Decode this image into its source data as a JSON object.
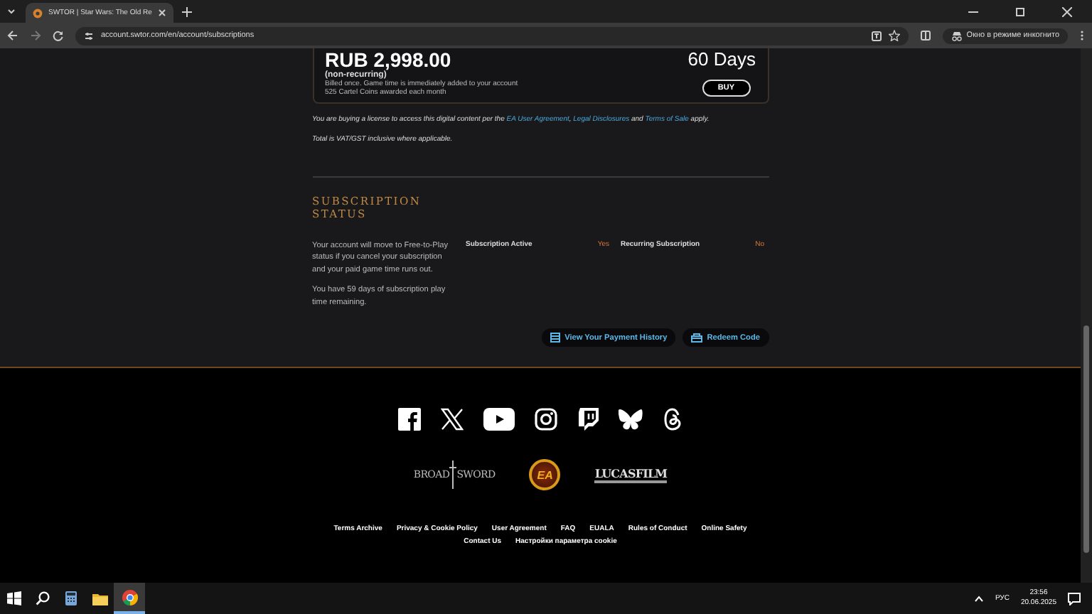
{
  "browser": {
    "tab_title": "SWTOR | Star Wars: The Old Re",
    "url": "account.swtor.com/en/account/subscriptions",
    "incognito_label": "Окно в режиме инкогнито"
  },
  "offer": {
    "price": "RUB 2,998.00",
    "note": "(non-recurring)",
    "details": [
      "Billed once. Game time is immediately added to your account",
      "525 Cartel Coins awarded each month"
    ],
    "duration": "60 Days",
    "buy_button": "BUY"
  },
  "legal": {
    "license_parts": [
      {
        "kind": "text",
        "text": "You are buying a license to access this digital content per the "
      },
      {
        "kind": "link",
        "text": "EA User Agreement"
      },
      {
        "kind": "text",
        "text": ", "
      },
      {
        "kind": "link",
        "text": "Legal Disclosures"
      },
      {
        "kind": "text",
        "text": " and "
      },
      {
        "kind": "link",
        "text": "Terms of Sale"
      },
      {
        "kind": "text",
        "text": " apply."
      }
    ],
    "vat_text": "Total is VAT/GST inclusive where applicable."
  },
  "subscription_status": {
    "title": "SUBSCRIPTION STATUS",
    "paragraphs": [
      "Your account will move to Free-to-Play status if you cancel your subscription and your paid game time runs out.",
      "You have 59 days of subscription play time remaining."
    ],
    "fields": [
      {
        "label": "Subscription Active",
        "value": "Yes"
      },
      {
        "label": "Recurring Subscription",
        "value": "No"
      }
    ],
    "buttons": [
      {
        "kind": "history",
        "label": "View Your Payment History"
      },
      {
        "kind": "redeem",
        "label": "Redeem Code"
      }
    ]
  },
  "footer": {
    "logos": [
      {
        "kind": "broadsword",
        "left": "BROAD",
        "right": "SWORD"
      },
      {
        "kind": "ea",
        "text": "EA"
      },
      {
        "kind": "lucasfilm",
        "text": "LUCASFILM"
      }
    ],
    "link_rows": [
      [
        "Terms Archive",
        "Privacy & Cookie Policy",
        "User Agreement",
        "FAQ",
        "EUALA",
        "Rules of Conduct",
        "Online Safety"
      ],
      [
        "Contact Us",
        "Настройки параметра cookie"
      ]
    ]
  },
  "taskbar": {
    "language": "РУС",
    "time": "23:56",
    "date": "20.06.2025"
  }
}
